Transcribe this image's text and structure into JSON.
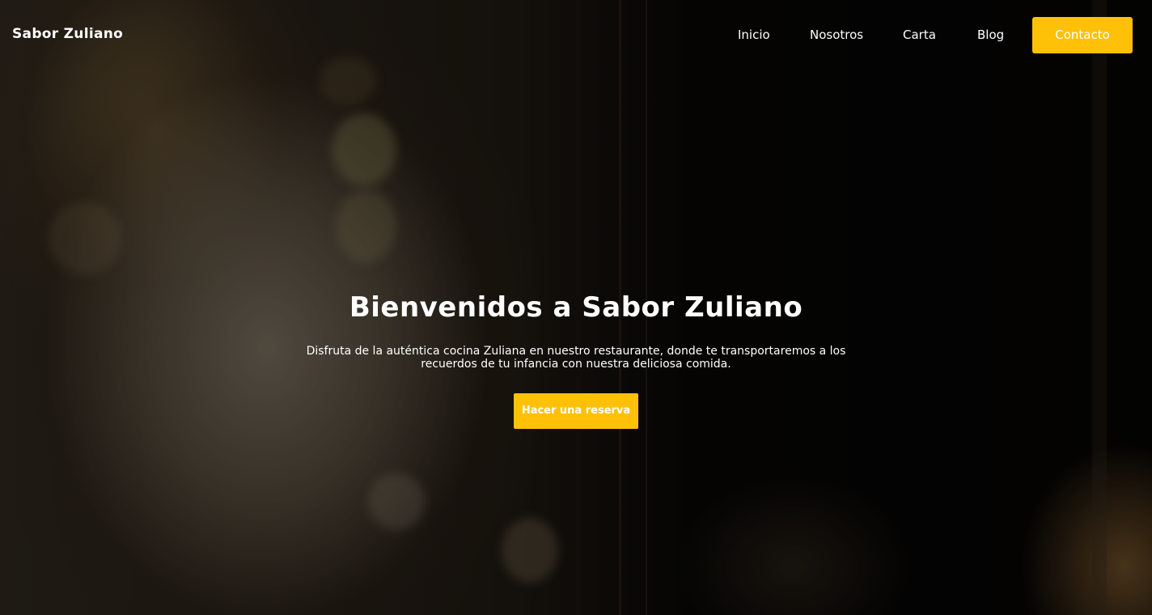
{
  "brand": {
    "name": "Sabor Zuliano"
  },
  "nav": {
    "items": [
      {
        "label": "Inicio"
      },
      {
        "label": "Nosotros"
      },
      {
        "label": "Carta"
      },
      {
        "label": "Blog"
      }
    ],
    "contact_label": "Contacto"
  },
  "hero": {
    "title": "Bienvenidos a Sabor Zuliano",
    "text": "Disfruta de la auténtica cocina Zuliana en nuestro restaurante, donde te transportaremos a los recuerdos de tu infancia con nuestra deliciosa comida.",
    "cta_label": "Hacer una reserva"
  },
  "colors": {
    "accent": "#ffc107",
    "text": "#ffffff",
    "background": "#050403"
  }
}
